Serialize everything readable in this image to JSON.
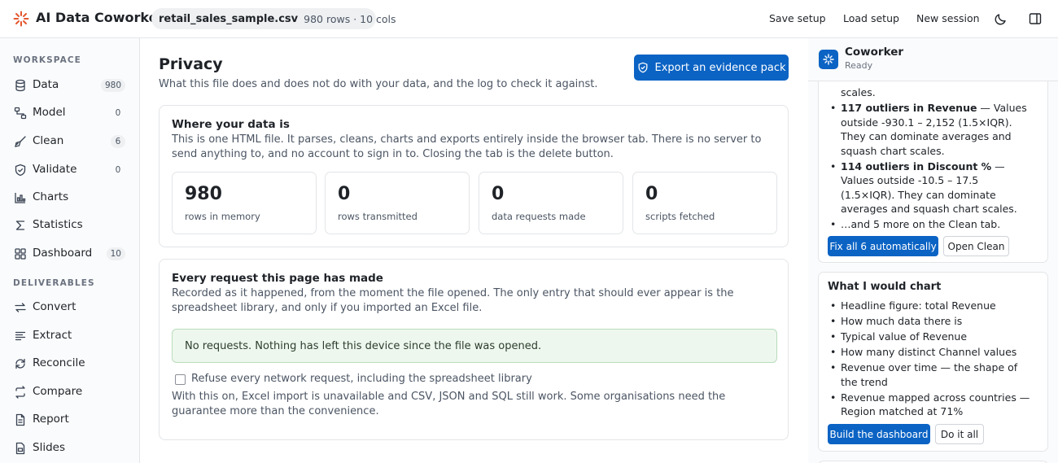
{
  "app": {
    "title": "AI Data Coworker"
  },
  "file": {
    "name": "retail_sales_sample.csv",
    "meta": "980 rows · 10 cols"
  },
  "topbar": {
    "save_label": "Save setup",
    "load_label": "Load setup",
    "new_label": "New session"
  },
  "sidebar": {
    "workspace_label": "WORKSPACE",
    "workspace_items": [
      {
        "label": "Data",
        "badge": "980"
      },
      {
        "label": "Model",
        "badge": "0"
      },
      {
        "label": "Clean",
        "badge": "6"
      },
      {
        "label": "Validate",
        "badge": "0"
      },
      {
        "label": "Charts",
        "badge": ""
      },
      {
        "label": "Statistics",
        "badge": ""
      },
      {
        "label": "Dashboard",
        "badge": "10"
      }
    ],
    "deliverables_label": "DELIVERABLES",
    "deliverable_items": [
      {
        "label": "Convert"
      },
      {
        "label": "Extract"
      },
      {
        "label": "Reconcile"
      },
      {
        "label": "Compare"
      },
      {
        "label": "Report"
      },
      {
        "label": "Slides"
      }
    ]
  },
  "main": {
    "title": "Privacy",
    "subtitle": "What this file does and does not do with your data, and the log to check it against.",
    "export_label": "Export an evidence pack",
    "where": {
      "title": "Where your data is",
      "text": "This is one HTML file. It parses, cleans, charts and exports entirely inside the browser tab. There is no server to send anything to, and no account to sign in to. Closing the tab is the delete button.",
      "stats": [
        {
          "value": "980",
          "label": "rows in memory"
        },
        {
          "value": "0",
          "label": "rows transmitted"
        },
        {
          "value": "0",
          "label": "data requests made"
        },
        {
          "value": "0",
          "label": "scripts fetched"
        }
      ]
    },
    "requests": {
      "title": "Every request this page has made",
      "text": "Recorded as it happened, from the moment the file opened. The only entry that should ever appear is the spreadsheet library, and only if you imported an Excel file.",
      "status": "No requests. Nothing has left this device since the file was opened.",
      "checkbox_label": "Refuse every network request, including the spreadsheet library",
      "note": "With this on, Excel import is unavailable and CSV, JSON and SQL still work. Some organisations need the guarantee more than the convenience."
    }
  },
  "coworker": {
    "title": "Coworker",
    "status": "Ready",
    "issues": {
      "continuation": "scales.",
      "items": [
        {
          "bold": "117 outliers in Revenue",
          "text": " — Values outside -930.1 – 2,152 (1.5×IQR). They can dominate averages and squash chart scales."
        },
        {
          "bold": "114 outliers in Discount %",
          "text": " — Values outside -10.5 – 17.5 (1.5×IQR). They can dominate averages and squash chart scales."
        }
      ],
      "more": "…and 5 more on the Clean tab.",
      "fix_label": "Fix all 6 automatically",
      "open_label": "Open Clean"
    },
    "charts": {
      "title": "What I would chart",
      "items": [
        "Headline figure: total Revenue",
        "How much data there is",
        "Typical value of Revenue",
        "How many distinct Channel values",
        "Revenue over time — the shape of the trend",
        "Revenue mapped across countries — Region matched at 71%"
      ],
      "build_label": "Build the dashboard",
      "do_label": "Do it all"
    }
  }
}
